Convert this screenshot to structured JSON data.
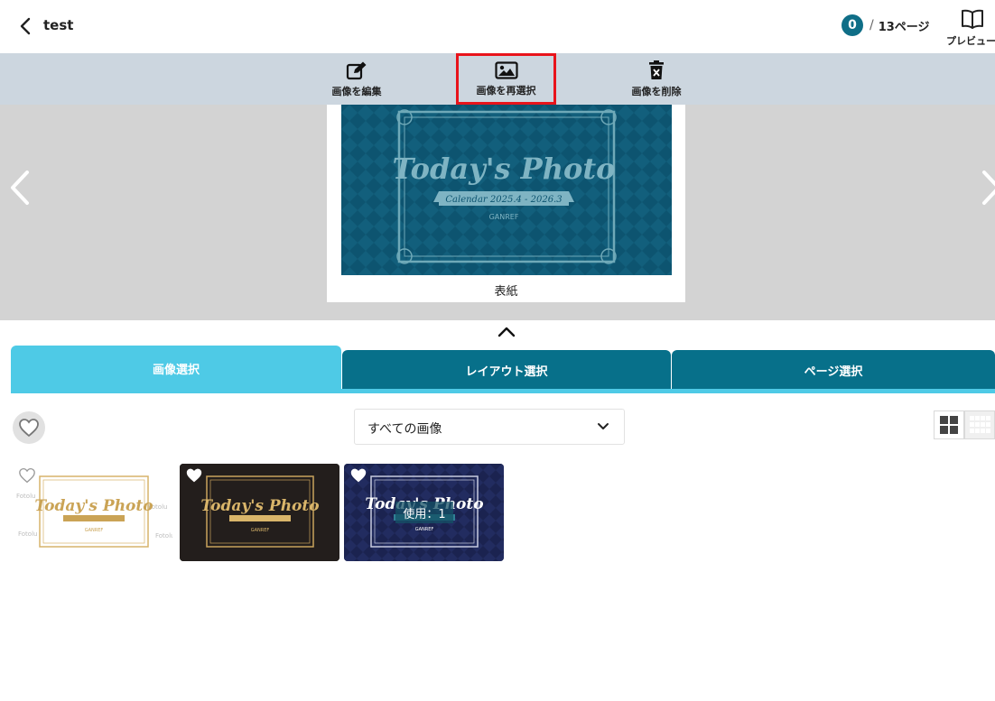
{
  "header": {
    "title": "test",
    "page_current": "0",
    "page_separator": "/",
    "page_total": "13ページ",
    "preview_label": "プレビュー"
  },
  "toolbar": {
    "edit_label": "画像を編集",
    "reselect_label": "画像を再選択",
    "delete_label": "画像を削除"
  },
  "preview": {
    "page_label": "表紙",
    "photo_title": "Today's Photo",
    "photo_subtitle": "Calendar 2025.4 - 2026.3",
    "photo_brand": "GANREF"
  },
  "tabs": [
    {
      "label": "画像選択",
      "active": true
    },
    {
      "label": "レイアウト選択",
      "active": false
    },
    {
      "label": "ページ選択",
      "active": false
    }
  ],
  "filter": {
    "selected": "すべての画像"
  },
  "thumbnails": [
    {
      "title": "Today's Photo",
      "brand": "GANREF",
      "watermark": "Fotolu",
      "favorite": false
    },
    {
      "title": "Today's Photo",
      "brand": "GANREF",
      "favorite": true
    },
    {
      "title": "Today's Photo",
      "brand": "GANREF",
      "favorite": true,
      "used_label": "使用：1"
    }
  ],
  "colors": {
    "accent": "#4ecae6",
    "accent_dark": "#07708a",
    "toolbar_bg": "#ccd6df",
    "highlight": "#e8141b"
  }
}
